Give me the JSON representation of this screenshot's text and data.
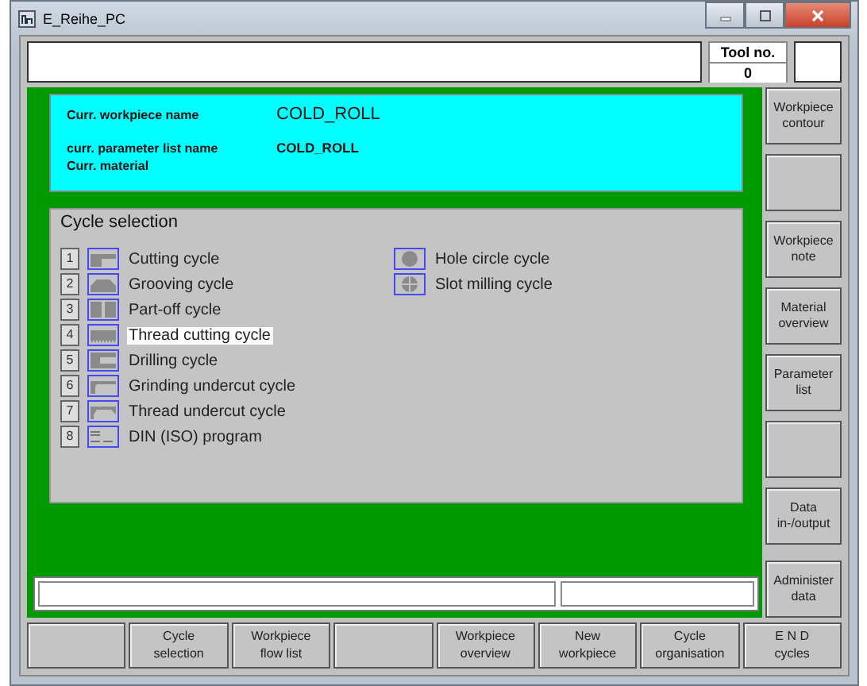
{
  "window": {
    "title": "E_Reihe_PC"
  },
  "tool": {
    "label": "Tool no.",
    "value": "0"
  },
  "info": {
    "workpiece_label": "Curr. workpiece name",
    "workpiece_value": "COLD_ROLL",
    "parameter_label": "curr. parameter list name",
    "parameter_value": "COLD_ROLL",
    "material_label": "Curr. material"
  },
  "cycle_selection": {
    "title": "Cycle selection",
    "items": [
      {
        "number": "1",
        "label": "Cutting cycle",
        "selected": false
      },
      {
        "number": "2",
        "label": "Grooving cycle",
        "selected": false
      },
      {
        "number": "3",
        "label": "Part-off cycle",
        "selected": false
      },
      {
        "number": "4",
        "label": "Thread cutting cycle",
        "selected": true
      },
      {
        "number": "5",
        "label": "Drilling cycle",
        "selected": false
      },
      {
        "number": "6",
        "label": "Grinding undercut cycle",
        "selected": false
      },
      {
        "number": "7",
        "label": "Thread undercut cycle",
        "selected": false
      },
      {
        "number": "8",
        "label": "DIN (ISO) program",
        "selected": false
      }
    ],
    "milling_items": [
      {
        "label": "Hole circle cycle",
        "selected": false
      },
      {
        "label": "Slot milling cycle",
        "selected": false
      }
    ]
  },
  "side_buttons": [
    {
      "kind": "label",
      "lines": [
        "Workpiece",
        "contour"
      ]
    },
    {
      "kind": "blank"
    },
    {
      "kind": "label",
      "lines": [
        "Workpiece",
        "note"
      ]
    },
    {
      "kind": "label",
      "lines": [
        "Material",
        "overview"
      ]
    },
    {
      "kind": "label",
      "lines": [
        "Parameter",
        "list"
      ]
    },
    {
      "kind": "blank"
    },
    {
      "kind": "label",
      "lines": [
        "Data",
        "in-/output"
      ]
    },
    {
      "kind": "label",
      "lines": [
        "Administer",
        "data"
      ]
    }
  ],
  "bottom_buttons": [
    {
      "kind": "blank"
    },
    {
      "kind": "label",
      "lines": [
        "Cycle",
        "selection"
      ]
    },
    {
      "kind": "label",
      "lines": [
        "Workpiece",
        "flow list"
      ]
    },
    {
      "kind": "blank"
    },
    {
      "kind": "label",
      "lines": [
        "Workpiece",
        "overview"
      ]
    },
    {
      "kind": "label",
      "lines": [
        "New",
        "workpiece"
      ]
    },
    {
      "kind": "label",
      "lines": [
        "Cycle",
        "organisation"
      ]
    },
    {
      "kind": "label",
      "lines": [
        "E N D",
        "cycles"
      ]
    }
  ]
}
